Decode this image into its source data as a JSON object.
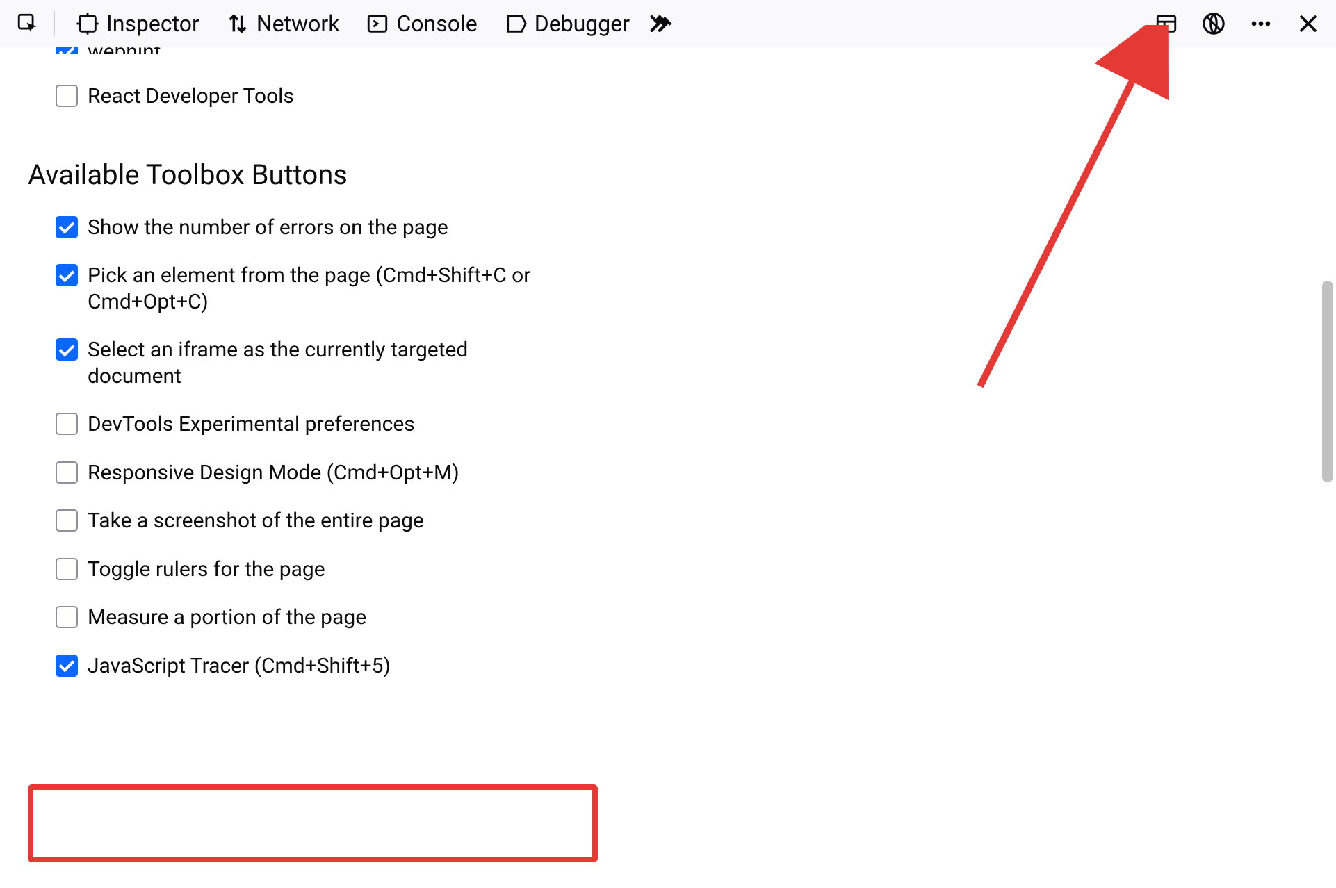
{
  "toolbar": {
    "tabs": {
      "inspector": "Inspector",
      "network": "Network",
      "console": "Console",
      "debugger": "Debugger"
    }
  },
  "top_options": [
    {
      "label": "webhint",
      "checked": true
    },
    {
      "label": "React Developer Tools",
      "checked": false
    }
  ],
  "section_heading": "Available Toolbox Buttons",
  "options": [
    {
      "label": "Show the number of errors on the page",
      "checked": true
    },
    {
      "label": "Pick an element from the page (Cmd+Shift+C or Cmd+Opt+C)",
      "checked": true
    },
    {
      "label": "Select an iframe as the currently targeted document",
      "checked": true
    },
    {
      "label": "DevTools Experimental preferences",
      "checked": false
    },
    {
      "label": "Responsive Design Mode (Cmd+Opt+M)",
      "checked": false
    },
    {
      "label": "Take a screenshot of the entire page",
      "checked": false
    },
    {
      "label": "Toggle rulers for the page",
      "checked": false
    },
    {
      "label": "Measure a portion of the page",
      "checked": false
    },
    {
      "label": "JavaScript Tracer (Cmd+Shift+5)",
      "checked": true
    }
  ]
}
